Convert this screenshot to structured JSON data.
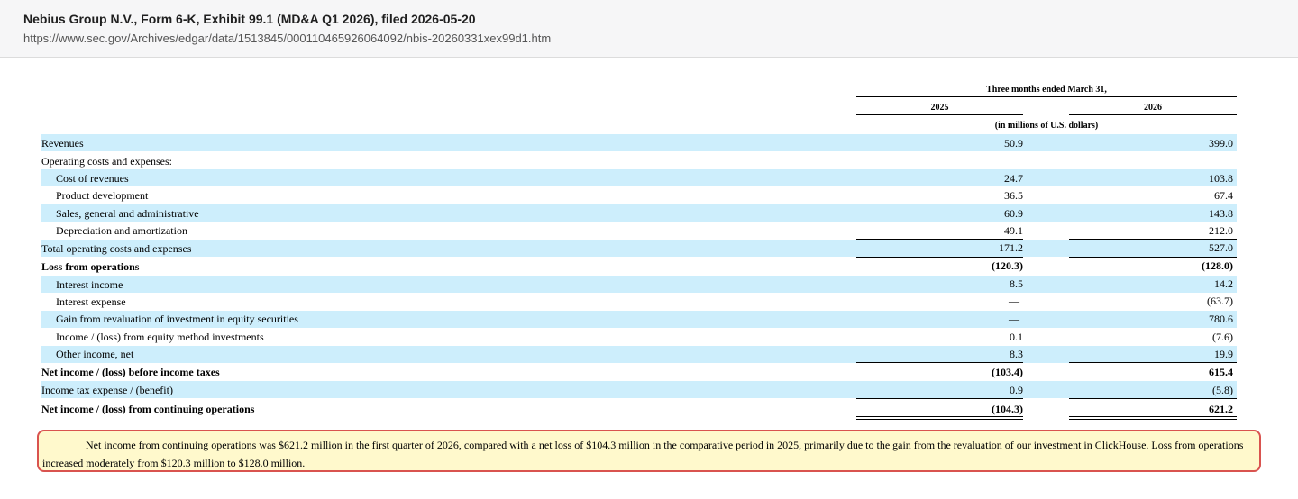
{
  "header": {
    "title": "Nebius Group N.V., Form 6-K, Exhibit 99.1 (MD&A Q1 2026), filed 2026-05-20",
    "url": "https://www.sec.gov/Archives/edgar/data/1513845/000110465926064092/nbis-20260331xex99d1.htm"
  },
  "table": {
    "period_header": "Three months ended March 31,",
    "col1": "2025",
    "col2": "2026",
    "unit_note": "(in millions of U.S. dollars)",
    "rows": [
      {
        "label": "Revenues",
        "v1": "50.9",
        "v2": "399.0"
      },
      {
        "label": "Operating costs and expenses:",
        "v1": "",
        "v2": ""
      },
      {
        "label": "Cost of revenues",
        "v1": "24.7",
        "v2": "103.8"
      },
      {
        "label": "Product development",
        "v1": "36.5",
        "v2": "67.4"
      },
      {
        "label": "Sales, general and administrative",
        "v1": "60.9",
        "v2": "143.8"
      },
      {
        "label": "Depreciation and amortization",
        "v1": "49.1",
        "v2": "212.0"
      },
      {
        "label": "Total operating costs and expenses",
        "v1": "171.2",
        "v2": "527.0"
      },
      {
        "label": "Loss from operations",
        "v1": "(120.3)",
        "v2": "(128.0)"
      },
      {
        "label": "Interest income",
        "v1": "8.5",
        "v2": "14.2"
      },
      {
        "label": "Interest expense",
        "v1": "—",
        "v2": "(63.7)"
      },
      {
        "label": "Gain from revaluation of investment in equity securities",
        "v1": "—",
        "v2": "780.6"
      },
      {
        "label": "Income / (loss) from equity method investments",
        "v1": "0.1",
        "v2": "(7.6)"
      },
      {
        "label": "Other income, net",
        "v1": "8.3",
        "v2": "19.9"
      },
      {
        "label": "Net income / (loss) before income taxes",
        "v1": "(103.4)",
        "v2": "615.4"
      },
      {
        "label": "Income tax expense / (benefit)",
        "v1": "0.9",
        "v2": "(5.8)"
      },
      {
        "label": "Net income / (loss) from continuing operations",
        "v1": "(104.3)",
        "v2": "621.2"
      }
    ]
  },
  "callout": {
    "text": "Net income from continuing operations was $621.2 million in the first quarter of 2026, compared with a net loss of $104.3 million in the comparative period in 2025, primarily due to the gain from the revaluation of our investment in ClickHouse. Loss from operations increased moderately from $120.3 million to $128.0 million."
  }
}
